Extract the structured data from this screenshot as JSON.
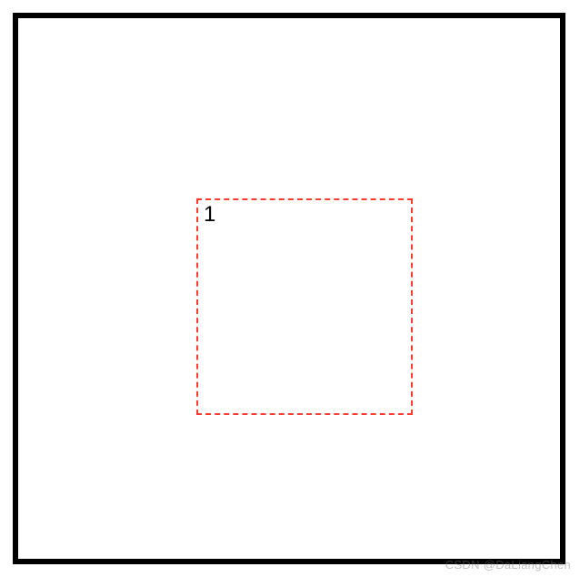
{
  "outer": {
    "border_color": "#000000",
    "border_width_px": 6,
    "fill": "#ffffff"
  },
  "inner": {
    "label": "1",
    "border_color": "#ff3b30",
    "border_style": "dashed",
    "border_width_px": 2,
    "fill": "transparent"
  },
  "watermark": {
    "text": "CSDN @DaLiangChen"
  }
}
